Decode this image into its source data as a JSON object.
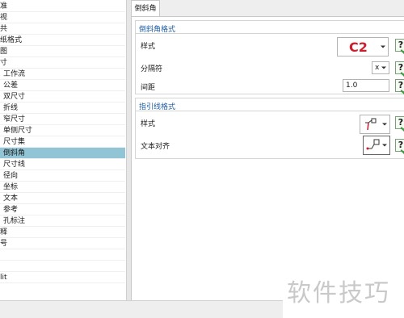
{
  "tree": {
    "items": [
      {
        "label": "准"
      },
      {
        "label": "视"
      },
      {
        "label": "共"
      },
      {
        "label": "纸格式"
      },
      {
        "label": "图"
      },
      {
        "label": "寸"
      },
      {
        "label": "工作流"
      },
      {
        "label": "公差"
      },
      {
        "label": "双尺寸"
      },
      {
        "label": "折线"
      },
      {
        "label": "窄尺寸"
      },
      {
        "label": "单侧尺寸"
      },
      {
        "label": "尺寸集"
      },
      {
        "label": "倒斜角"
      },
      {
        "label": "尺寸线"
      },
      {
        "label": "径向"
      },
      {
        "label": "坐标"
      },
      {
        "label": "文本"
      },
      {
        "label": "参考"
      },
      {
        "label": "孔标注"
      },
      {
        "label": "释"
      },
      {
        "label": "号"
      },
      {
        "label": ""
      },
      {
        "label": ""
      },
      {
        "label": "lit"
      }
    ],
    "selected_label": "倒斜角"
  },
  "tab": {
    "label": "倒斜角"
  },
  "chamfer_format": {
    "title": "倒斜角格式",
    "style_label": "样式",
    "style_value": "C2",
    "separator_label": "分隔符",
    "separator_value": "x",
    "spacing_label": "间距",
    "spacing_value": "1.0"
  },
  "leader_format": {
    "title": "指引线格式",
    "style_label": "样式",
    "text_align_label": "文本对齐"
  },
  "help": {
    "glyph": "?"
  },
  "watermark": {
    "text": "软件技巧"
  },
  "colors": {
    "selection": "#91c5d6",
    "section_title": "#1f5fa6",
    "style_value_red": "#cc1e2c"
  }
}
